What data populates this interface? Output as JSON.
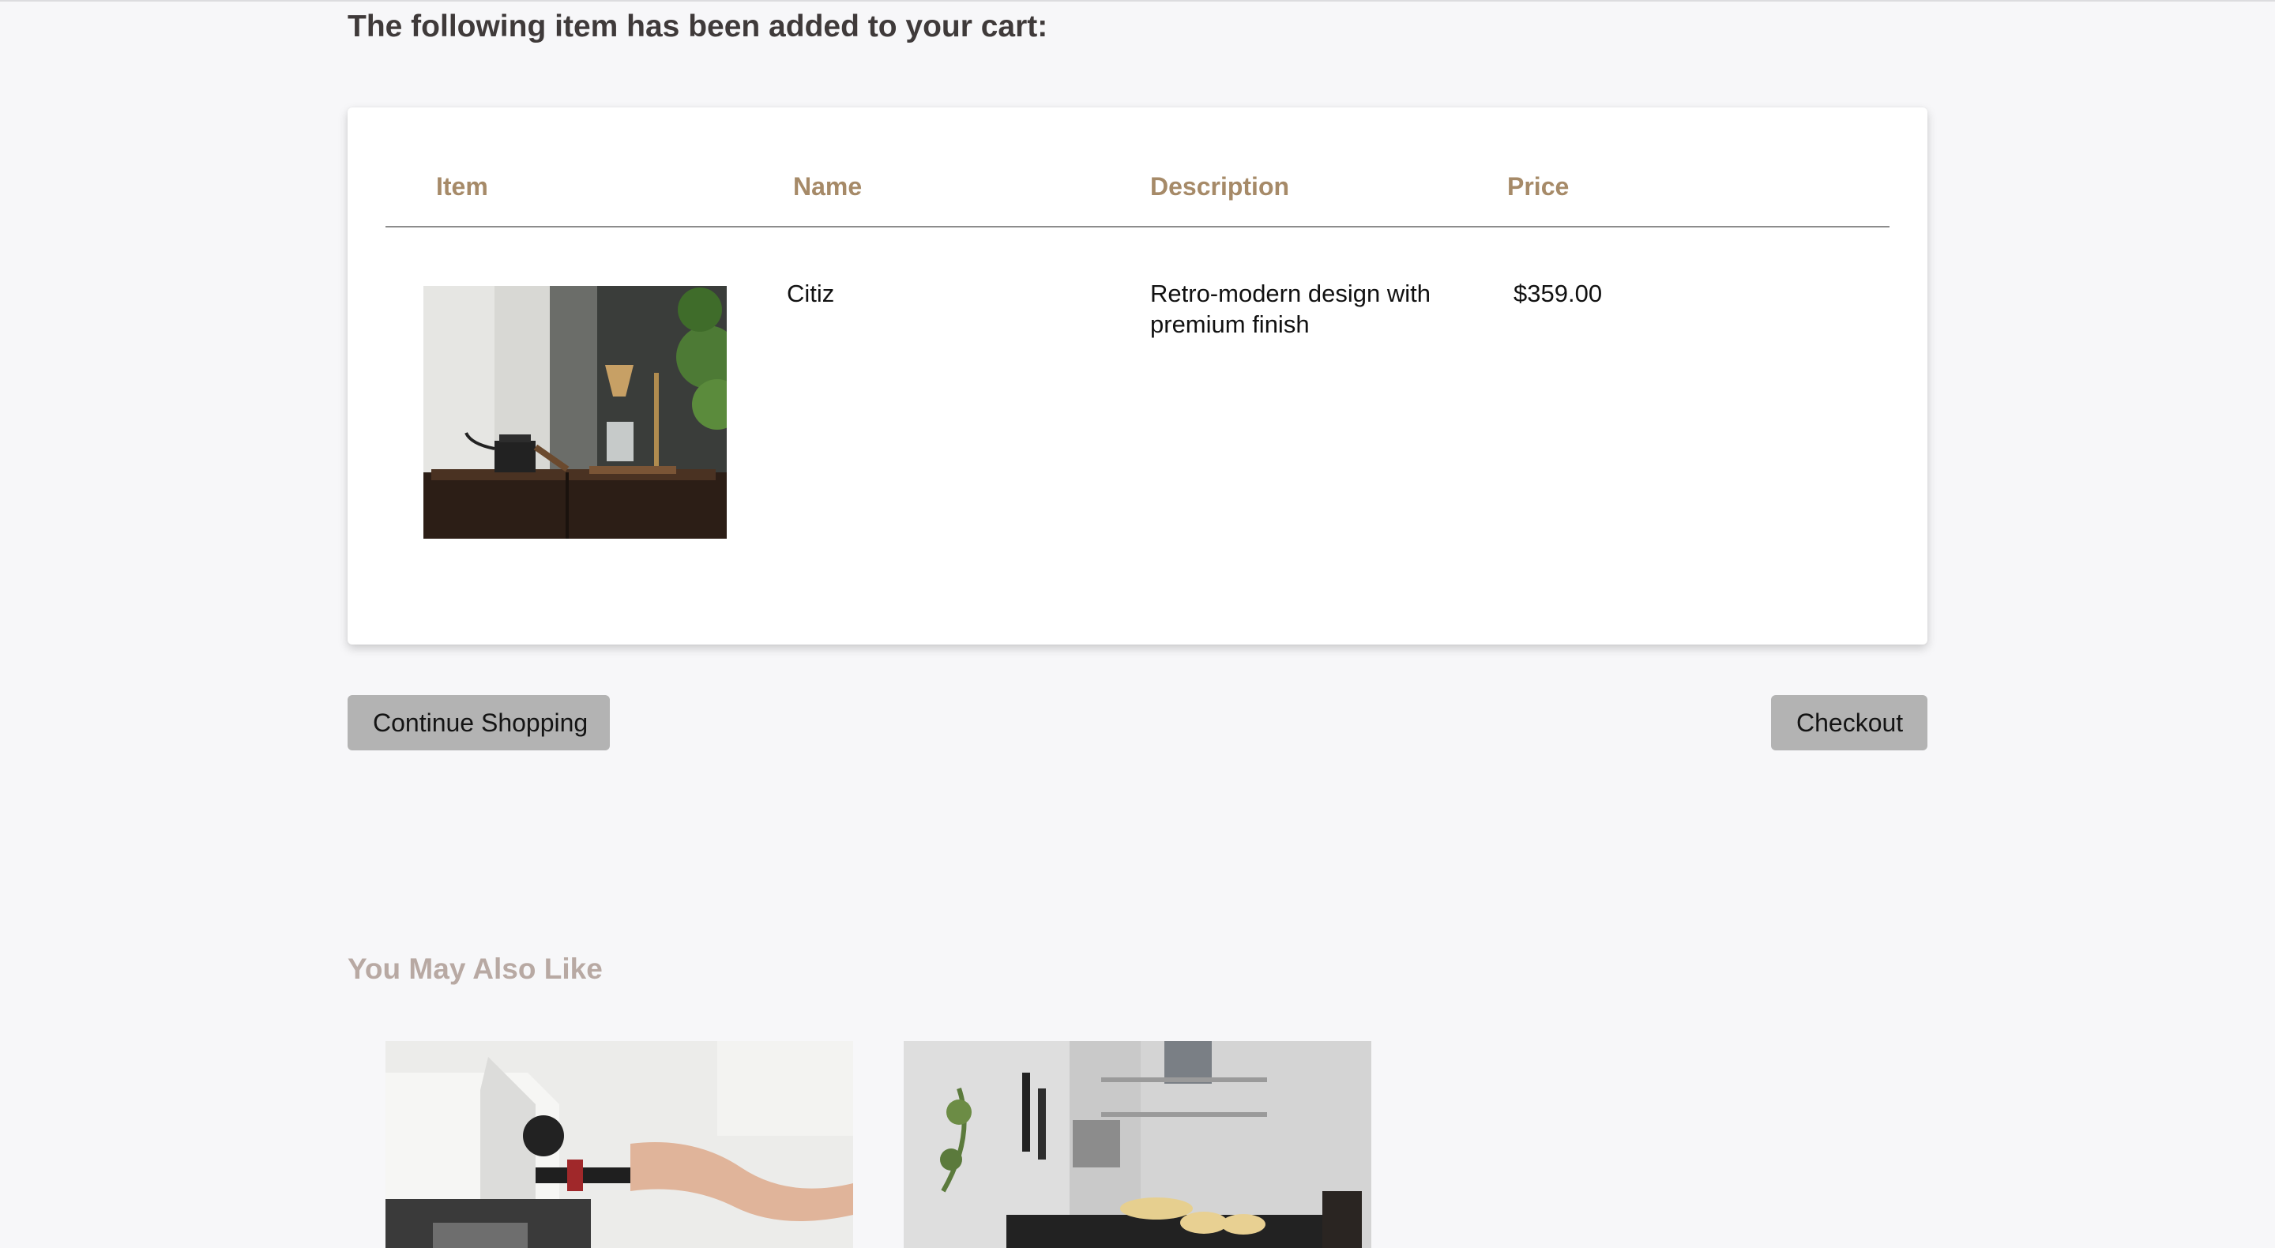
{
  "page": {
    "heading": "The following item has been added to your cart:"
  },
  "cart": {
    "columns": {
      "item": "Item",
      "name": "Name",
      "description": "Description",
      "price": "Price"
    },
    "row": {
      "image_subject": "pour-over coffee set with kettle on wooden table",
      "name": "Citiz",
      "description": "Retro-modern design with premium finish",
      "price": "$359.00"
    }
  },
  "actions": {
    "continue_label": "Continue Shopping",
    "checkout_label": "Checkout"
  },
  "recommendations": {
    "title": "You May Also Like",
    "items": [
      {
        "image_subject": "barista using espresso machine with portafilter"
      },
      {
        "image_subject": "kitchen counter with espresso cups and utensil rack"
      }
    ]
  },
  "colors": {
    "background": "#f7f7f9",
    "header_text": "#a68a68",
    "section_title": "#b8a9a3",
    "button_bg": "#b3b3b3"
  }
}
